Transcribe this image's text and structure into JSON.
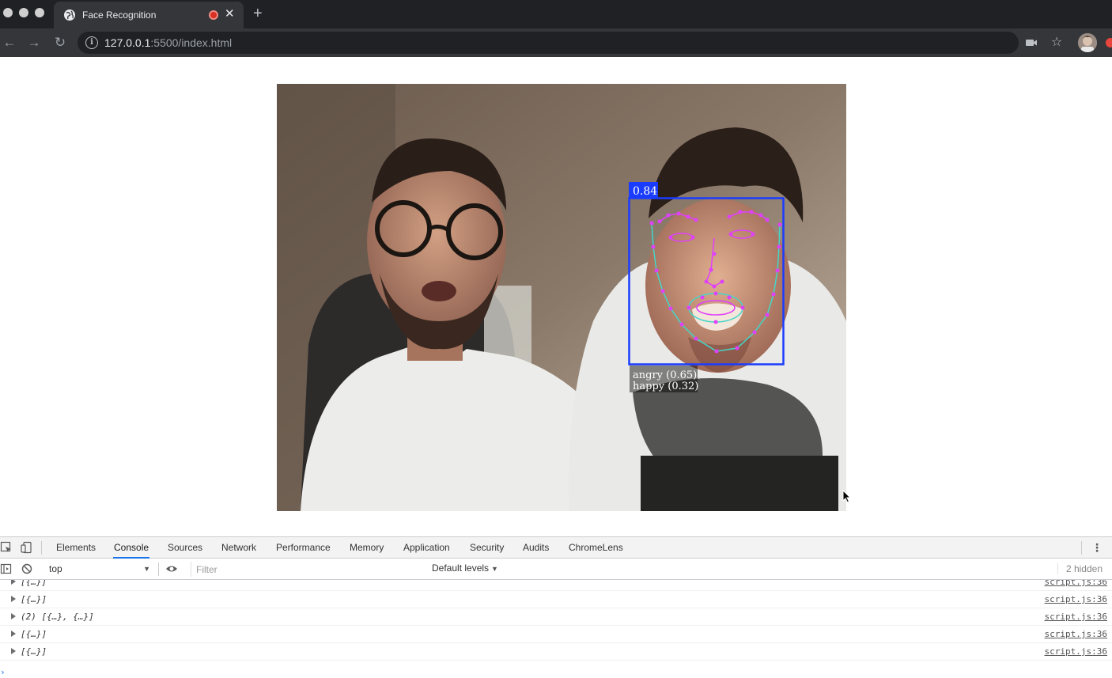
{
  "browser": {
    "tab_title": "Face Recognition",
    "url_host": "127.0.0.1",
    "url_rest": ":5500/index.html",
    "icons": [
      "globe-icon",
      "recording-icon",
      "close-icon",
      "new-tab-icon",
      "back-icon",
      "forward-icon",
      "reload-icon",
      "info-icon",
      "camera-icon",
      "star-icon",
      "profile-avatar"
    ]
  },
  "page": {
    "detection": {
      "score": "0.84",
      "expressions": [
        "angry (0.65)",
        "happy (0.32)"
      ],
      "box_color": "#1a3cff",
      "landmark_color": "#e040fb",
      "jaw_color": "#44d6c8"
    }
  },
  "devtools": {
    "tabs": [
      "Elements",
      "Console",
      "Sources",
      "Network",
      "Performance",
      "Memory",
      "Application",
      "Security",
      "Audits",
      "ChromeLens"
    ],
    "active_tab": "Console",
    "context": "top",
    "filter_placeholder": "Filter",
    "levels": "Default levels",
    "hidden_count": "2 hidden",
    "logs": [
      {
        "text": "[{…}]",
        "source": "script.js:36"
      },
      {
        "text": "[{…}]",
        "source": "script.js:36"
      },
      {
        "text": "(2) [{…}, {…}]",
        "source": "script.js:36"
      },
      {
        "text": "[{…}]",
        "source": "script.js:36"
      },
      {
        "text": "[{…}]",
        "source": "script.js:36"
      }
    ],
    "accent": "#1a73e8"
  }
}
